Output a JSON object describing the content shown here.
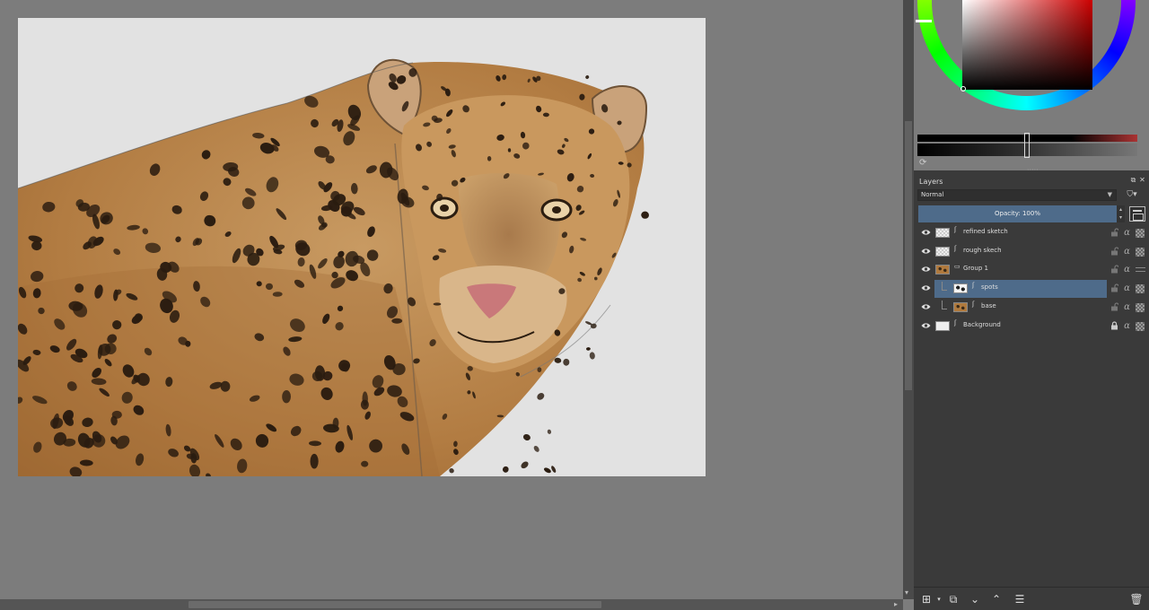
{
  "layers_panel": {
    "title": "Layers",
    "blend_mode": "Normal",
    "opacity_label": "Opacity:  100%",
    "layers": [
      {
        "name": "refined sketch",
        "type": "paint",
        "thumb": "checker",
        "visible": true,
        "selected": false,
        "indent": 0
      },
      {
        "name": "rough skech",
        "type": "paint",
        "thumb": "checker",
        "visible": true,
        "selected": false,
        "indent": 0
      },
      {
        "name": "Group 1",
        "type": "group",
        "thumb": "fur",
        "visible": true,
        "selected": false,
        "indent": 0
      },
      {
        "name": "spots",
        "type": "paint",
        "thumb": "spots",
        "visible": true,
        "selected": true,
        "indent": 1
      },
      {
        "name": "base",
        "type": "paint",
        "thumb": "fur",
        "visible": true,
        "selected": false,
        "indent": 1
      },
      {
        "name": "Background",
        "type": "paint",
        "thumb": "white",
        "visible": true,
        "selected": false,
        "indent": 0,
        "locked": true
      }
    ]
  },
  "toolbar": {
    "add_layer_icon": "add-layer-icon",
    "duplicate_icon": "duplicate-layer-icon",
    "move_down_icon": "move-down-icon",
    "move_up_icon": "move-up-icon",
    "properties_icon": "properties-icon",
    "delete_icon": "trash-icon"
  },
  "colors": {
    "canvas_bg": "#7c7c7c",
    "panel_bg": "#3a3a3a",
    "selection": "#4e6b8a",
    "document_bg": "#e2e2e2"
  }
}
